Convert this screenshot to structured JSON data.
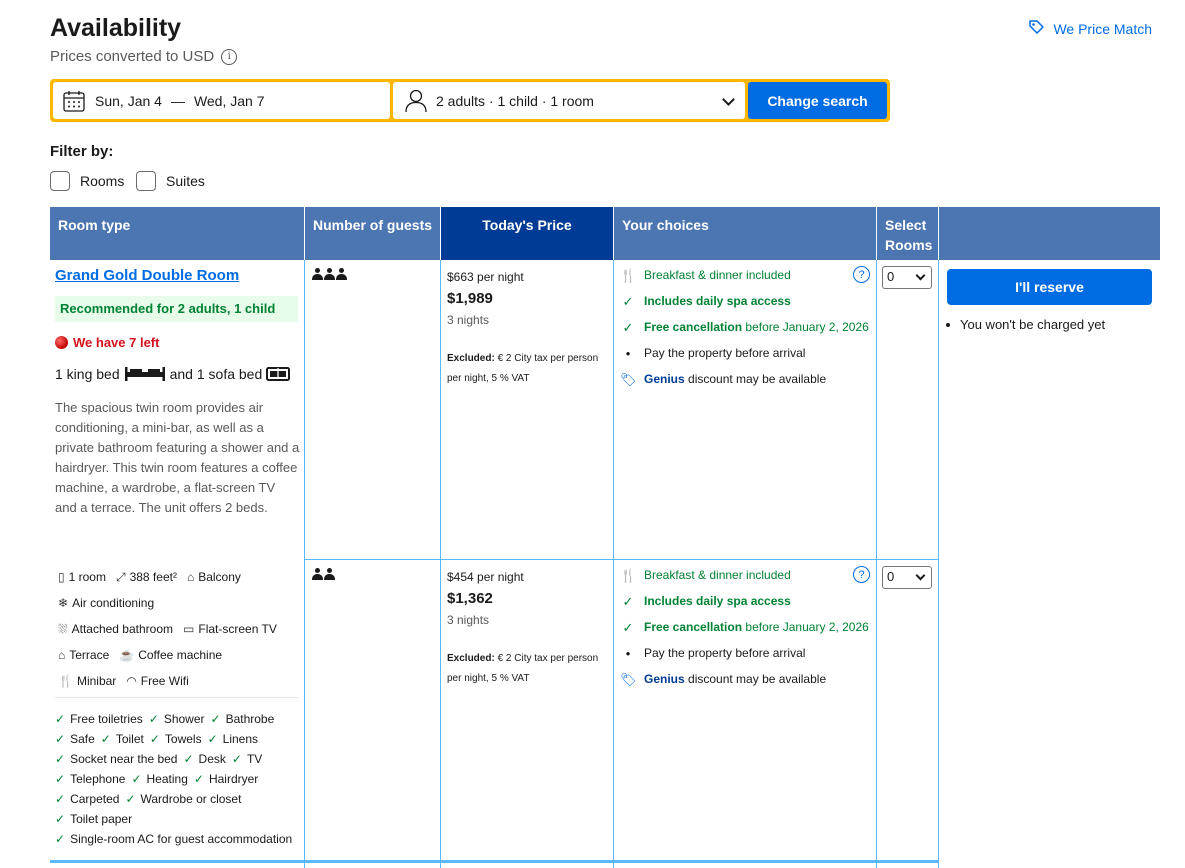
{
  "header": {
    "title": "Availability",
    "subtitle": "Prices converted to USD",
    "info_icon": "i",
    "price_match": "We Price Match"
  },
  "search": {
    "check_in": "Sun, Jan 4",
    "separator": "—",
    "check_out": "Wed, Jan 7",
    "guests": "2 adults · 1 child · 1 room",
    "button": "Change search"
  },
  "filter": {
    "title": "Filter by:",
    "options": [
      "Rooms",
      "Suites"
    ]
  },
  "table": {
    "headers": {
      "room_type": "Room type",
      "guests": "Number of guests",
      "today_price": "Today's Price",
      "choices": "Your choices",
      "select_rooms": "Select Rooms"
    }
  },
  "room": {
    "name": "Grand Gold Double Room",
    "recommended": "Recommended for 2 adults, 1 child",
    "left": "We have 7 left",
    "beds_a": "1 king bed",
    "beds_b": "and 1 sofa bed",
    "description": "The spacious twin room provides air conditioning, a mini-bar, as well as a private bathroom featuring a shower and a hairdryer. This twin room features a coffee machine, a wardrobe, a flat-screen TV and a terrace. The unit offers 2 beds.",
    "facilities": {
      "rooms": "1 room",
      "size": "388 feet²",
      "balcony": "Balcony",
      "ac": "Air conditioning",
      "bathroom": "Attached bathroom",
      "tv": "Flat-screen TV",
      "terrace": "Terrace",
      "coffee": "Coffee machine",
      "minibar": "Minibar",
      "wifi": "Free Wifi"
    },
    "amenities": {
      "a1": "Free toiletries",
      "a2": "Shower",
      "a3": "Bathrobe",
      "a4": "Safe",
      "a5": "Toilet",
      "a6": "Towels",
      "a7": "Linens",
      "a8": "Socket near the bed",
      "a9": "Desk",
      "a10": "TV",
      "a11": "Telephone",
      "a12": "Heating",
      "a13": "Hairdryer",
      "a14": "Carpeted",
      "a15": "Wardrobe or closet",
      "a16": "Toilet paper",
      "a17": "Single-room AC for guest accommodation"
    }
  },
  "options": [
    {
      "price_per_night": "$663 per night",
      "total": "$1,989",
      "nights": "3 nights",
      "excluded_label": "Excluded:",
      "excluded_text": "€ 2 City tax per person per night, 5 % VAT",
      "meal": "Breakfast & dinner included",
      "spa": "Includes daily spa access",
      "cancel_bold": "Free cancellation",
      "cancel_rest": "before January 2, 2026",
      "pay": "Pay the property before arrival",
      "genius": "Genius",
      "genius_rest": "discount may be available",
      "select_value": "0"
    },
    {
      "price_per_night": "$454 per night",
      "total": "$1,362",
      "nights": "3 nights",
      "excluded_label": "Excluded:",
      "excluded_text": "€ 2 City tax per person per night, 5 % VAT",
      "meal": "Breakfast & dinner included",
      "spa": "Includes daily spa access",
      "cancel_bold": "Free cancellation",
      "cancel_rest": "before January 2, 2026",
      "pay": "Pay the property before arrival",
      "genius": "Genius",
      "genius_rest": "discount may be available",
      "select_value": "0"
    }
  ],
  "reserve": {
    "button": "I'll reserve",
    "note": "You won't be charged yet"
  },
  "colors": {
    "brand_blue": "#006ce4",
    "header_blue": "#4c76b2",
    "today_price_blue": "#003b95",
    "search_yellow": "#ffb700",
    "green": "#008234",
    "red": "#d4111e"
  }
}
